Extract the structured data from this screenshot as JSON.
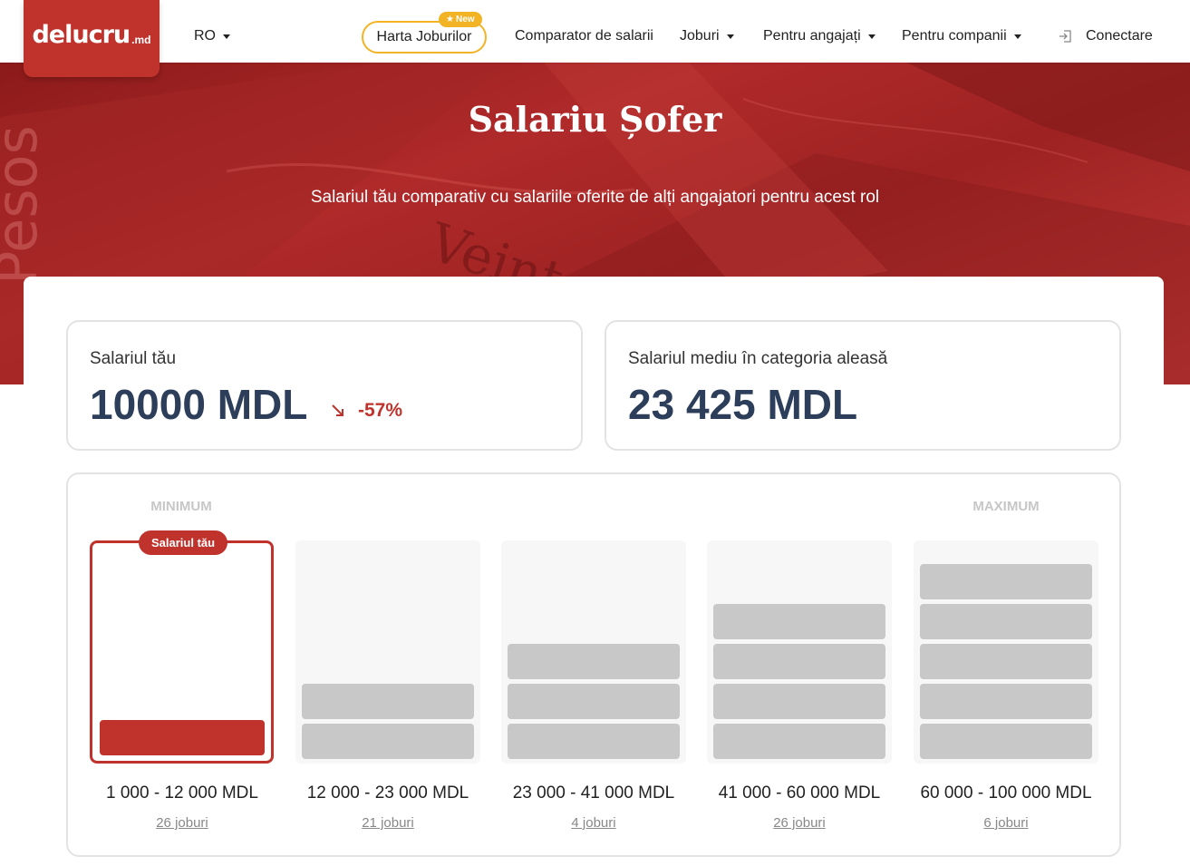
{
  "header": {
    "logo_main": "delucru",
    "logo_tld": ".md",
    "language": "RO",
    "harta_label": "Harta Joburilor",
    "new_badge": "New",
    "nav": {
      "comparator": "Comparator de salarii",
      "jobs": "Joburi",
      "employees": "Pentru angajați",
      "companies": "Pentru companii",
      "login": "Conectare"
    }
  },
  "hero": {
    "title": "Salariu Șofer",
    "subtitle": "Salariul tău comparativ cu salariile oferite de alți angajatori pentru acest rol"
  },
  "stats": {
    "your_salary": {
      "label": "Salariul tău",
      "value": "10000 MDL",
      "diff": "-57%"
    },
    "average": {
      "label": "Salariul mediu în categoria aleasă",
      "value": "23 425 MDL"
    }
  },
  "distribution": {
    "minimum_label": "MINIMUM",
    "maximum_label": "MAXIMUM",
    "your_badge": "Salariul tău",
    "active_index": 0,
    "buckets": [
      {
        "range": "1 000 - 12 000 MDL",
        "jobs": "26 joburi",
        "level": 1
      },
      {
        "range": "12 000 - 23 000 MDL",
        "jobs": "21 joburi",
        "level": 2
      },
      {
        "range": "23 000 - 41 000 MDL",
        "jobs": "4 joburi",
        "level": 3
      },
      {
        "range": "41 000 - 60 000 MDL",
        "jobs": "26 joburi",
        "level": 4
      },
      {
        "range": "60 000 - 100 000 MDL",
        "jobs": "6 joburi",
        "level": 5
      }
    ]
  }
}
